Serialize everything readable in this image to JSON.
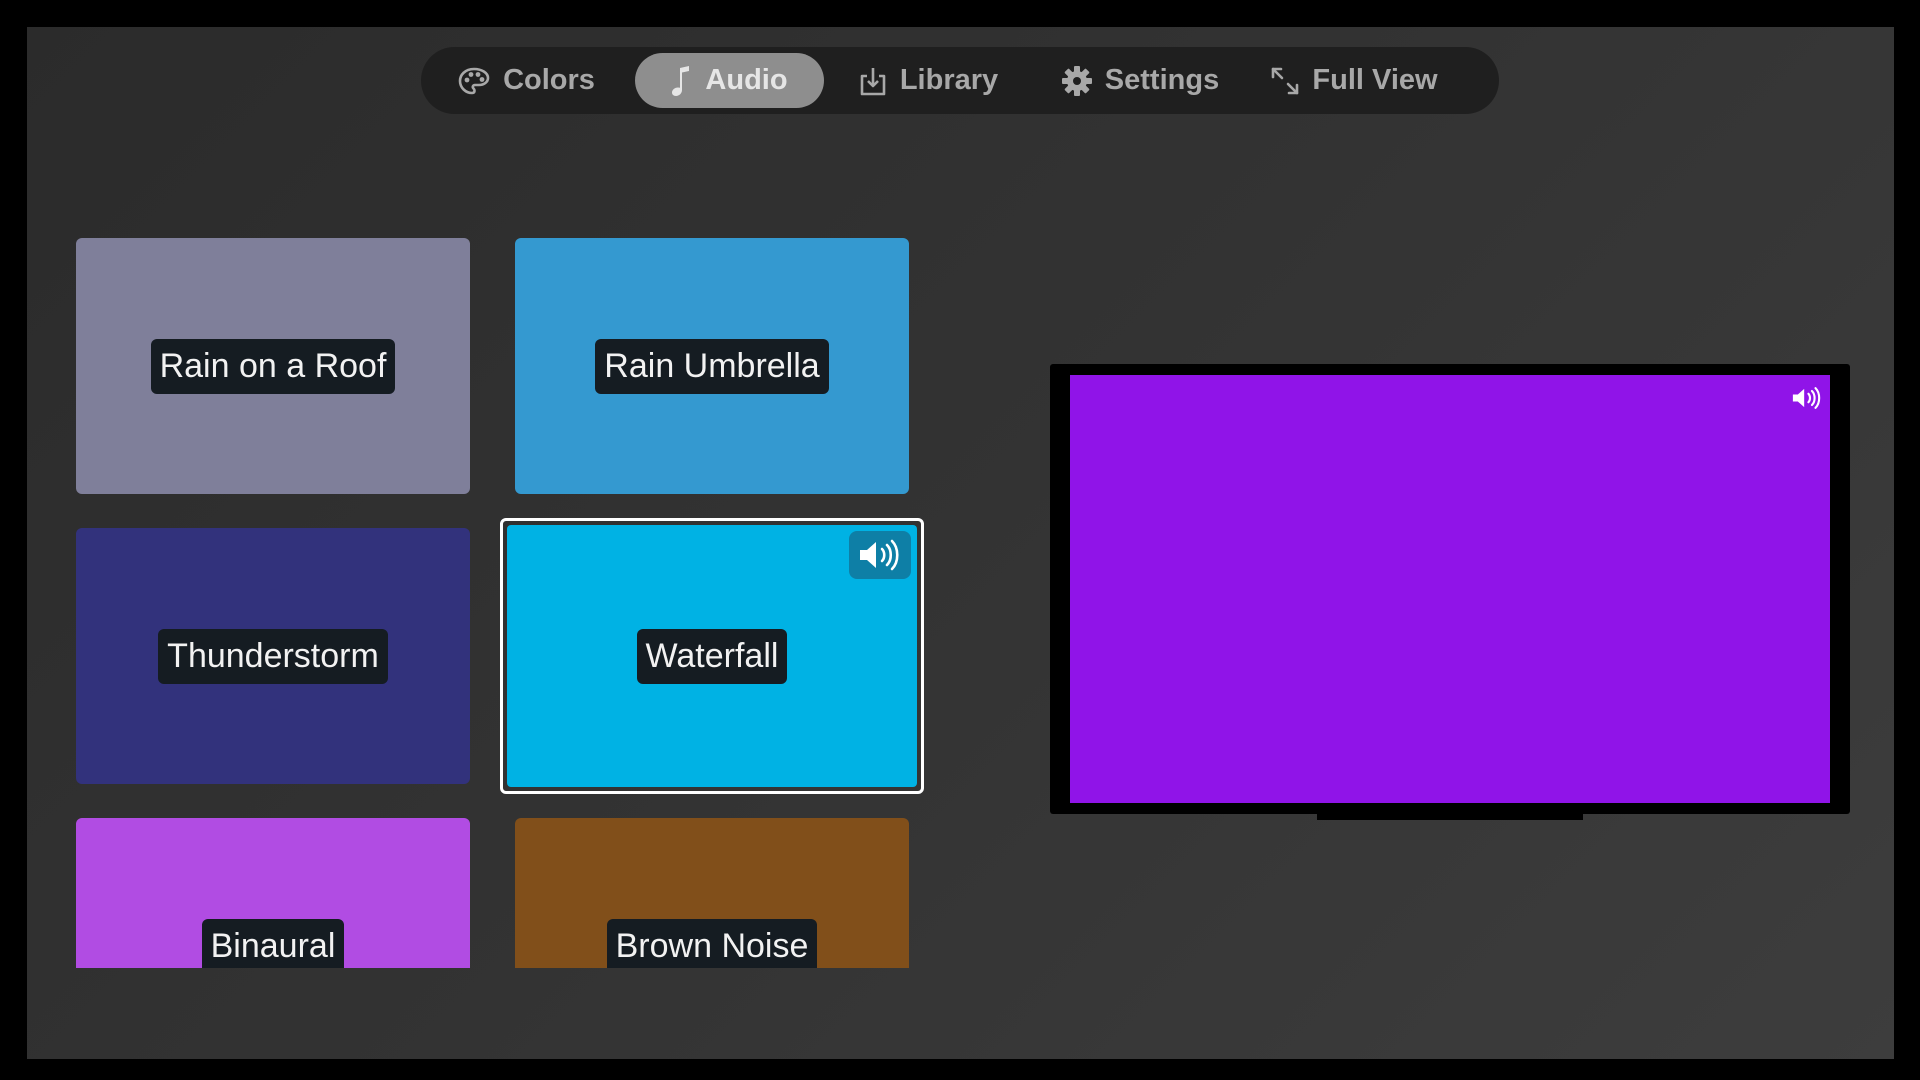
{
  "nav": {
    "items": [
      {
        "label": "Colors",
        "icon": "palette-icon"
      },
      {
        "label": "Audio",
        "icon": "music-note-icon",
        "active": true
      },
      {
        "label": "Library",
        "icon": "download-tray-icon"
      },
      {
        "label": "Settings",
        "icon": "gear-icon"
      },
      {
        "label": "Full View",
        "icon": "expand-arrows-icon"
      }
    ]
  },
  "tiles": [
    {
      "label": "Rain on a Roof",
      "color": "#7f7f9a"
    },
    {
      "label": "Rain Umbrella",
      "color": "#3499d0"
    },
    {
      "label": "Thunderstorm",
      "color": "#32327c"
    },
    {
      "label": "Waterfall",
      "color": "#00b2e4",
      "selected": true,
      "icon": "speaker-icon"
    },
    {
      "label": "Binaural",
      "color": "#b14ce3"
    },
    {
      "label": "Brown Noise",
      "color": "#814f1a"
    }
  ],
  "preview": {
    "color": "#9014e8",
    "icon": "speaker-icon"
  },
  "colors": {
    "nav_bg": "#1f1f1f",
    "nav_active": "#8e8e8e",
    "label_bg": "#151c22"
  }
}
